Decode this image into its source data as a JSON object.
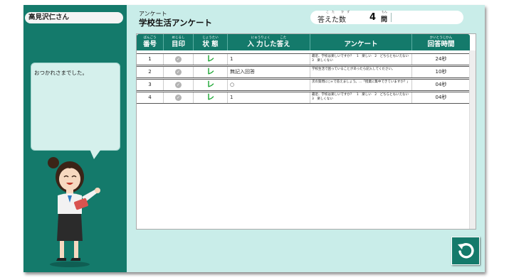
{
  "user": {
    "name": "高見沢仁さん"
  },
  "message": "おつかれさまでした。",
  "header": {
    "category": "アンケート",
    "title": "学校生活アンケート",
    "count_label": "答えた数",
    "count_label_ruby": "こた かず",
    "count_value": "4",
    "count_unit": "問",
    "count_unit_ruby": "もん"
  },
  "table": {
    "columns": [
      {
        "ruby": "ばんごう",
        "label": "番号"
      },
      {
        "ruby": "めじるし",
        "label": "目印"
      },
      {
        "ruby": "じょうたい",
        "label": "状 態"
      },
      {
        "ruby": "にゅうりょく　　　こた",
        "label": "入 力した答え"
      },
      {
        "ruby": "",
        "label": "アンケート"
      },
      {
        "ruby": "かいとうじかん",
        "label": "回答時間"
      }
    ],
    "rows": [
      {
        "no": "1",
        "status": "レ",
        "answer": "1",
        "survey": "最近、学校は楽しいですか？　1　楽しい　2　どちらともいえない　3　楽しくない",
        "time": "24秒"
      },
      {
        "no": "2",
        "status": "レ",
        "answer": "無記入回答",
        "survey": "学校生活で困っていることがあったら記入してください。",
        "time": "10秒"
      },
      {
        "no": "3",
        "status": "レ",
        "answer": "○",
        "survey": "次の質問に○×で答えましょう。…「授業に集中できていますか？」",
        "time": "04秒"
      },
      {
        "no": "4",
        "status": "レ",
        "answer": "1",
        "survey": "最近、学校は楽しいですか？　1　楽しい　2　どちらともいえない　3　楽しくない",
        "time": "04秒"
      }
    ]
  },
  "icons": {
    "mark": "check-circle-icon",
    "back": "back-arrow-icon"
  },
  "colors": {
    "accent": "#147a6b",
    "background": "#c9ede9",
    "status": "#1aa531"
  }
}
